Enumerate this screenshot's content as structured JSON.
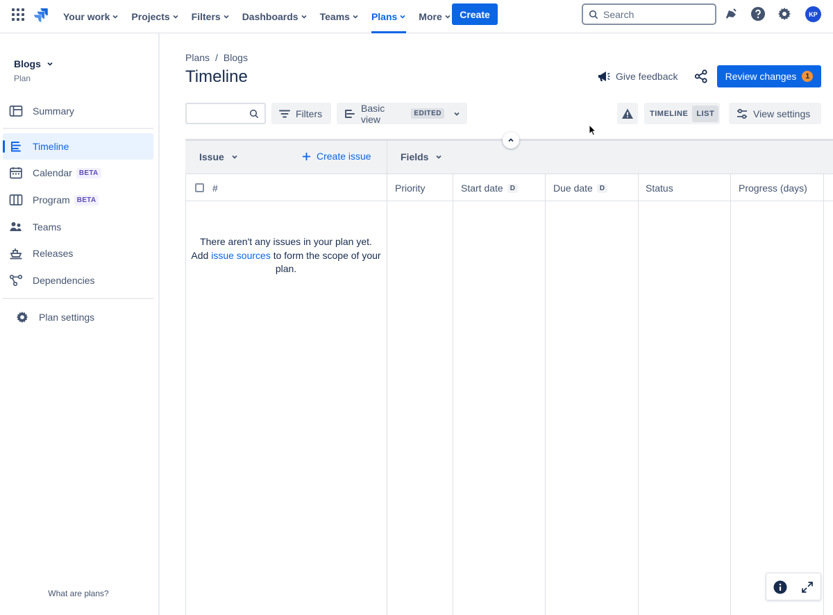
{
  "nav": {
    "items": [
      {
        "label": "Your work",
        "active": false
      },
      {
        "label": "Projects",
        "active": false
      },
      {
        "label": "Filters",
        "active": false
      },
      {
        "label": "Dashboards",
        "active": false
      },
      {
        "label": "Teams",
        "active": false
      },
      {
        "label": "Plans",
        "active": true
      },
      {
        "label": "More",
        "active": false
      }
    ],
    "create_label": "Create",
    "search_placeholder": "Search",
    "avatar_initials": "KP"
  },
  "sidebar": {
    "plan_name": "Blogs",
    "plan_type": "Plan",
    "items": [
      {
        "label": "Summary",
        "icon": "summary-icon",
        "badge": "",
        "active": false
      },
      {
        "label": "Timeline",
        "icon": "timeline-icon",
        "badge": "",
        "active": true
      },
      {
        "label": "Calendar",
        "icon": "calendar-icon",
        "badge": "BETA",
        "active": false
      },
      {
        "label": "Program",
        "icon": "program-icon",
        "badge": "BETA",
        "active": false
      },
      {
        "label": "Teams",
        "icon": "teams-icon",
        "badge": "",
        "active": false
      },
      {
        "label": "Releases",
        "icon": "releases-icon",
        "badge": "",
        "active": false
      },
      {
        "label": "Dependencies",
        "icon": "dependencies-icon",
        "badge": "",
        "active": false
      }
    ],
    "settings_label": "Plan settings",
    "footer": "What are plans?"
  },
  "header": {
    "breadcrumb": [
      "Plans",
      "/",
      "Blogs"
    ],
    "title": "Timeline",
    "feedback_label": "Give feedback",
    "review_label": "Review changes",
    "review_count": "1"
  },
  "toolbar": {
    "filters_label": "Filters",
    "view_label": "Basic view",
    "view_badge": "EDITED",
    "toggle_timeline": "TIMELINE",
    "toggle_list": "LIST",
    "toggle_selected": "LIST",
    "view_settings_label": "View settings"
  },
  "table": {
    "issue_header": "Issue",
    "create_issue_label": "Create issue",
    "fields_header": "Fields",
    "hash": "#",
    "columns": [
      {
        "label": "Priority",
        "badge": ""
      },
      {
        "label": "Start date",
        "badge": "D"
      },
      {
        "label": "Due date",
        "badge": "D"
      },
      {
        "label": "Status",
        "badge": ""
      },
      {
        "label": "Progress (days)",
        "badge": ""
      }
    ],
    "empty_line1": "There aren't any issues in your plan yet.",
    "empty_pre": "Add ",
    "empty_link": "issue sources",
    "empty_post": " to form the scope of your plan."
  },
  "colors": {
    "accent": "#0C66E4",
    "badge_orange": "#F79233"
  }
}
